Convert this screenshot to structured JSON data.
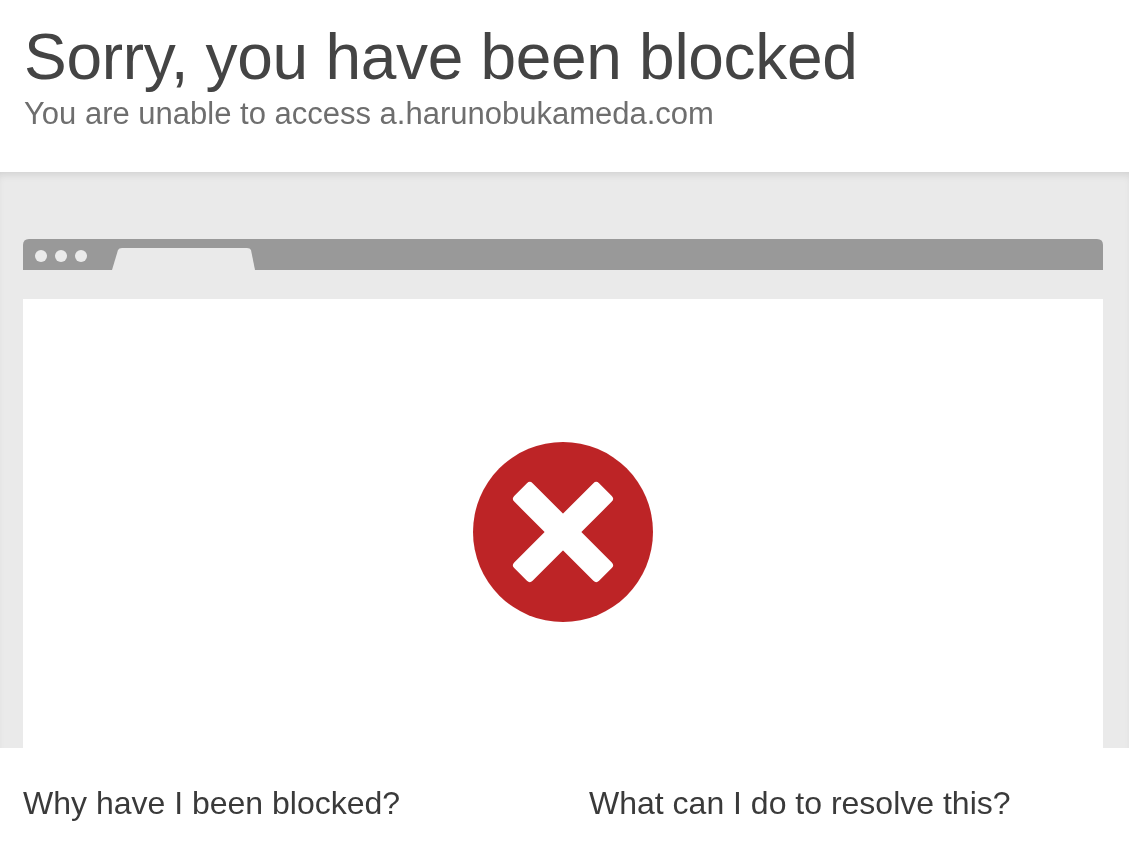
{
  "header": {
    "title": "Sorry, you have been blocked",
    "subtitle": "You are unable to access a.harunobukameda.com"
  },
  "sections": [
    {
      "heading": "Why have I been blocked?"
    },
    {
      "heading": "What can I do to resolve this?"
    }
  ]
}
